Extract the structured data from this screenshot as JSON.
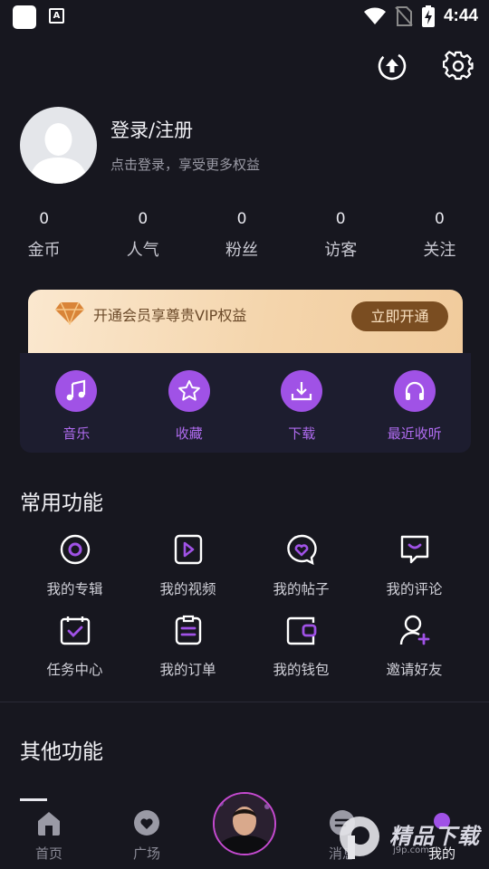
{
  "status_bar": {
    "time": "4:44",
    "notif_letter": "A"
  },
  "profile": {
    "title": "登录/注册",
    "subtitle": "点击登录，享受更多权益"
  },
  "stats": [
    {
      "value": "0",
      "label": "金币"
    },
    {
      "value": "0",
      "label": "人气"
    },
    {
      "value": "0",
      "label": "粉丝"
    },
    {
      "value": "0",
      "label": "访客"
    },
    {
      "value": "0",
      "label": "关注"
    }
  ],
  "vip": {
    "text": "开通会员享尊贵VIP权益",
    "button": "立即开通"
  },
  "quick": [
    {
      "label": "音乐",
      "icon": "music-note-icon"
    },
    {
      "label": "收藏",
      "icon": "star-icon"
    },
    {
      "label": "下载",
      "icon": "download-icon"
    },
    {
      "label": "最近收听",
      "icon": "headphones-icon"
    }
  ],
  "common": {
    "title": "常用功能",
    "items": [
      {
        "label": "我的专辑",
        "icon": "album-icon"
      },
      {
        "label": "我的视频",
        "icon": "video-icon"
      },
      {
        "label": "我的帖子",
        "icon": "post-icon"
      },
      {
        "label": "我的评论",
        "icon": "comment-icon"
      },
      {
        "label": "任务中心",
        "icon": "task-icon"
      },
      {
        "label": "我的订单",
        "icon": "order-icon"
      },
      {
        "label": "我的钱包",
        "icon": "wallet-icon"
      },
      {
        "label": "邀请好友",
        "icon": "invite-icon"
      }
    ]
  },
  "other": {
    "title": "其他功能"
  },
  "tabs": [
    {
      "label": "首页",
      "icon": "home-icon"
    },
    {
      "label": "广场",
      "icon": "plaza-icon"
    },
    {
      "label": "消息",
      "icon": "message-icon"
    },
    {
      "label": "我的",
      "icon": "profile-icon"
    }
  ],
  "watermark": {
    "text": "精品下载",
    "sub": "j9p.com"
  },
  "colors": {
    "accent": "#a052e6",
    "background": "#17171f",
    "vip_gold": "#f4d5ac"
  }
}
